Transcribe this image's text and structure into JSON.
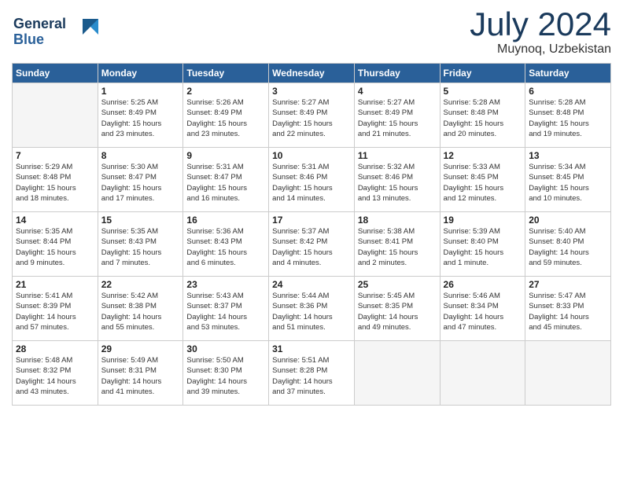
{
  "header": {
    "logo_line1": "General",
    "logo_line2": "Blue",
    "title": "July 2024",
    "location": "Muynoq, Uzbekistan"
  },
  "days_of_week": [
    "Sunday",
    "Monday",
    "Tuesday",
    "Wednesday",
    "Thursday",
    "Friday",
    "Saturday"
  ],
  "weeks": [
    [
      {
        "day": "",
        "info": "",
        "empty": true
      },
      {
        "day": "1",
        "info": "Sunrise: 5:25 AM\nSunset: 8:49 PM\nDaylight: 15 hours\nand 23 minutes."
      },
      {
        "day": "2",
        "info": "Sunrise: 5:26 AM\nSunset: 8:49 PM\nDaylight: 15 hours\nand 23 minutes."
      },
      {
        "day": "3",
        "info": "Sunrise: 5:27 AM\nSunset: 8:49 PM\nDaylight: 15 hours\nand 22 minutes."
      },
      {
        "day": "4",
        "info": "Sunrise: 5:27 AM\nSunset: 8:49 PM\nDaylight: 15 hours\nand 21 minutes."
      },
      {
        "day": "5",
        "info": "Sunrise: 5:28 AM\nSunset: 8:48 PM\nDaylight: 15 hours\nand 20 minutes."
      },
      {
        "day": "6",
        "info": "Sunrise: 5:28 AM\nSunset: 8:48 PM\nDaylight: 15 hours\nand 19 minutes."
      }
    ],
    [
      {
        "day": "7",
        "info": "Sunrise: 5:29 AM\nSunset: 8:48 PM\nDaylight: 15 hours\nand 18 minutes."
      },
      {
        "day": "8",
        "info": "Sunrise: 5:30 AM\nSunset: 8:47 PM\nDaylight: 15 hours\nand 17 minutes."
      },
      {
        "day": "9",
        "info": "Sunrise: 5:31 AM\nSunset: 8:47 PM\nDaylight: 15 hours\nand 16 minutes."
      },
      {
        "day": "10",
        "info": "Sunrise: 5:31 AM\nSunset: 8:46 PM\nDaylight: 15 hours\nand 14 minutes."
      },
      {
        "day": "11",
        "info": "Sunrise: 5:32 AM\nSunset: 8:46 PM\nDaylight: 15 hours\nand 13 minutes."
      },
      {
        "day": "12",
        "info": "Sunrise: 5:33 AM\nSunset: 8:45 PM\nDaylight: 15 hours\nand 12 minutes."
      },
      {
        "day": "13",
        "info": "Sunrise: 5:34 AM\nSunset: 8:45 PM\nDaylight: 15 hours\nand 10 minutes."
      }
    ],
    [
      {
        "day": "14",
        "info": "Sunrise: 5:35 AM\nSunset: 8:44 PM\nDaylight: 15 hours\nand 9 minutes."
      },
      {
        "day": "15",
        "info": "Sunrise: 5:35 AM\nSunset: 8:43 PM\nDaylight: 15 hours\nand 7 minutes."
      },
      {
        "day": "16",
        "info": "Sunrise: 5:36 AM\nSunset: 8:43 PM\nDaylight: 15 hours\nand 6 minutes."
      },
      {
        "day": "17",
        "info": "Sunrise: 5:37 AM\nSunset: 8:42 PM\nDaylight: 15 hours\nand 4 minutes."
      },
      {
        "day": "18",
        "info": "Sunrise: 5:38 AM\nSunset: 8:41 PM\nDaylight: 15 hours\nand 2 minutes."
      },
      {
        "day": "19",
        "info": "Sunrise: 5:39 AM\nSunset: 8:40 PM\nDaylight: 15 hours\nand 1 minute."
      },
      {
        "day": "20",
        "info": "Sunrise: 5:40 AM\nSunset: 8:40 PM\nDaylight: 14 hours\nand 59 minutes."
      }
    ],
    [
      {
        "day": "21",
        "info": "Sunrise: 5:41 AM\nSunset: 8:39 PM\nDaylight: 14 hours\nand 57 minutes."
      },
      {
        "day": "22",
        "info": "Sunrise: 5:42 AM\nSunset: 8:38 PM\nDaylight: 14 hours\nand 55 minutes."
      },
      {
        "day": "23",
        "info": "Sunrise: 5:43 AM\nSunset: 8:37 PM\nDaylight: 14 hours\nand 53 minutes."
      },
      {
        "day": "24",
        "info": "Sunrise: 5:44 AM\nSunset: 8:36 PM\nDaylight: 14 hours\nand 51 minutes."
      },
      {
        "day": "25",
        "info": "Sunrise: 5:45 AM\nSunset: 8:35 PM\nDaylight: 14 hours\nand 49 minutes."
      },
      {
        "day": "26",
        "info": "Sunrise: 5:46 AM\nSunset: 8:34 PM\nDaylight: 14 hours\nand 47 minutes."
      },
      {
        "day": "27",
        "info": "Sunrise: 5:47 AM\nSunset: 8:33 PM\nDaylight: 14 hours\nand 45 minutes."
      }
    ],
    [
      {
        "day": "28",
        "info": "Sunrise: 5:48 AM\nSunset: 8:32 PM\nDaylight: 14 hours\nand 43 minutes."
      },
      {
        "day": "29",
        "info": "Sunrise: 5:49 AM\nSunset: 8:31 PM\nDaylight: 14 hours\nand 41 minutes."
      },
      {
        "day": "30",
        "info": "Sunrise: 5:50 AM\nSunset: 8:30 PM\nDaylight: 14 hours\nand 39 minutes."
      },
      {
        "day": "31",
        "info": "Sunrise: 5:51 AM\nSunset: 8:28 PM\nDaylight: 14 hours\nand 37 minutes."
      },
      {
        "day": "",
        "info": "",
        "empty": true
      },
      {
        "day": "",
        "info": "",
        "empty": true
      },
      {
        "day": "",
        "info": "",
        "empty": true
      }
    ]
  ]
}
